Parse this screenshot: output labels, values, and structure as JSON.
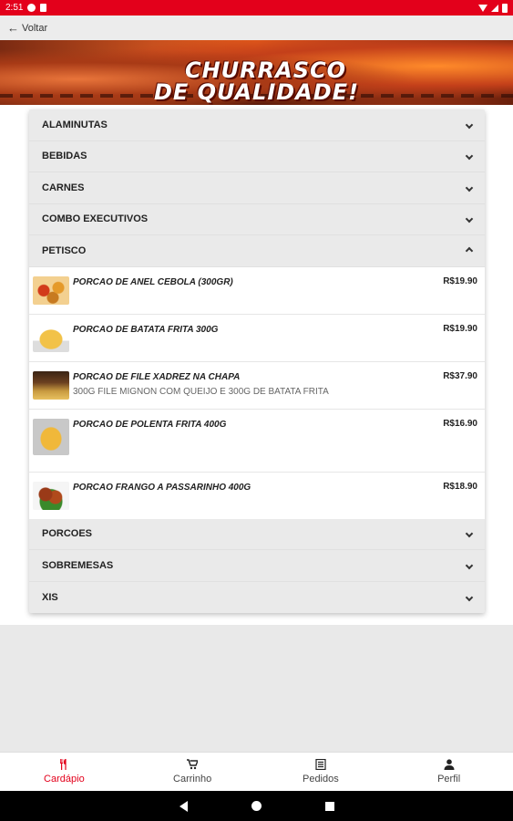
{
  "status_bar": {
    "time": "2:51"
  },
  "topbar": {
    "back_label": "Voltar"
  },
  "banner": {
    "line1": "CHURRASCO",
    "line2": "DE QUALIDADE!"
  },
  "categories_before": [
    {
      "label": "ALAMINUTAS"
    },
    {
      "label": "BEBIDAS"
    },
    {
      "label": "CARNES"
    },
    {
      "label": "COMBO EXECUTIVOS"
    }
  ],
  "expanded_category": {
    "label": "PETISCO"
  },
  "products": [
    {
      "name": "PORCAO DE ANEL CEBOLA (300GR)",
      "description": "",
      "price": "R$19.90"
    },
    {
      "name": "PORCAO DE BATATA FRITA 300G",
      "description": "",
      "price": "R$19.90"
    },
    {
      "name": "PORCAO DE FILE XADREZ NA CHAPA",
      "description": "300G FILE MIGNON COM QUEIJO E 300G DE BATATA FRITA",
      "price": "R$37.90"
    },
    {
      "name": "PORCAO DE POLENTA FRITA 400G",
      "description": "",
      "price": "R$16.90"
    },
    {
      "name": "PORCAO FRANGO A PASSARINHO 400G",
      "description": "",
      "price": "R$18.90"
    }
  ],
  "categories_after": [
    {
      "label": "PORCOES"
    },
    {
      "label": "SOBREMESAS"
    },
    {
      "label": "XIS"
    }
  ],
  "bottom_nav": [
    {
      "label": "Cardápio",
      "icon": "cutlery-icon"
    },
    {
      "label": "Carrinho",
      "icon": "cart-icon"
    },
    {
      "label": "Pedidos",
      "icon": "list-icon"
    },
    {
      "label": "Perfil",
      "icon": "person-icon"
    }
  ],
  "colors": {
    "accent": "#e3001b"
  }
}
